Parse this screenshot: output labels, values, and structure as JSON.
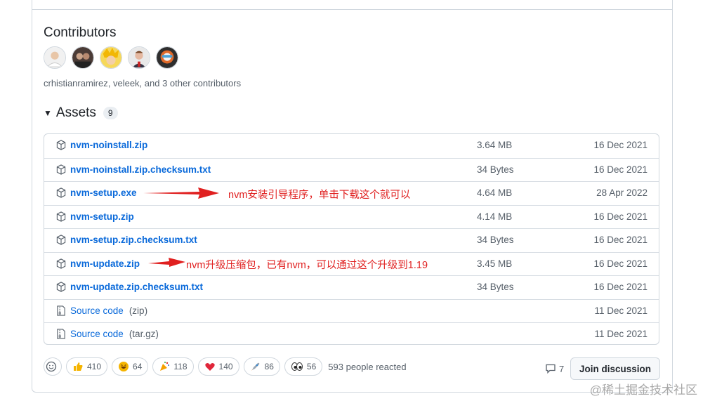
{
  "contributors": {
    "heading": "Contributors",
    "summary": "crhistianramirez, veleek, and 3 other contributors",
    "avatars": [
      "crhistianramirez",
      "veleek",
      "contributor-3",
      "contributor-4",
      "contributor-5"
    ]
  },
  "assets": {
    "title": "Assets",
    "count": "9",
    "rows": [
      {
        "name": "nvm-noinstall.zip",
        "size": "3.64 MB",
        "date": "16 Dec 2021",
        "icon": "package-icon"
      },
      {
        "name": "nvm-noinstall.zip.checksum.txt",
        "size": "34 Bytes",
        "date": "16 Dec 2021",
        "icon": "package-icon"
      },
      {
        "name": "nvm-setup.exe",
        "size": "4.64 MB",
        "date": "28 Apr 2022",
        "icon": "package-icon"
      },
      {
        "name": "nvm-setup.zip",
        "size": "4.14 MB",
        "date": "16 Dec 2021",
        "icon": "package-icon"
      },
      {
        "name": "nvm-setup.zip.checksum.txt",
        "size": "34 Bytes",
        "date": "16 Dec 2021",
        "icon": "package-icon"
      },
      {
        "name": "nvm-update.zip",
        "size": "3.45 MB",
        "date": "16 Dec 2021",
        "icon": "package-icon"
      },
      {
        "name": "nvm-update.zip.checksum.txt",
        "size": "34 Bytes",
        "date": "16 Dec 2021",
        "icon": "package-icon"
      },
      {
        "name": "Source code",
        "suffix": "(zip)",
        "size": "",
        "date": "11 Dec 2021",
        "icon": "file-zip-icon"
      },
      {
        "name": "Source code",
        "suffix": "(tar.gz)",
        "size": "",
        "date": "11 Dec 2021",
        "icon": "file-zip-icon"
      }
    ]
  },
  "annotations": {
    "setup_exe": "nvm安装引导程序，单击下载这个就可以",
    "update_zip": "nvm升级压缩包，已有nvm，可以通过这个升级到1.19"
  },
  "reactions": {
    "items": [
      {
        "emoji": "thumbs-up-icon",
        "count": "410"
      },
      {
        "emoji": "laugh-icon",
        "count": "64"
      },
      {
        "emoji": "hooray-icon",
        "count": "118"
      },
      {
        "emoji": "heart-icon",
        "count": "140"
      },
      {
        "emoji": "rocket-icon",
        "count": "86"
      },
      {
        "emoji": "eyes-icon",
        "count": "56"
      }
    ],
    "summary": "593 people reacted"
  },
  "discussion": {
    "comment_count": "7",
    "join_label": "Join discussion"
  },
  "watermark": "@稀土掘金技术社区",
  "colors": {
    "link": "#0969da",
    "annotation": "#e02020",
    "border": "#d0d7de"
  }
}
